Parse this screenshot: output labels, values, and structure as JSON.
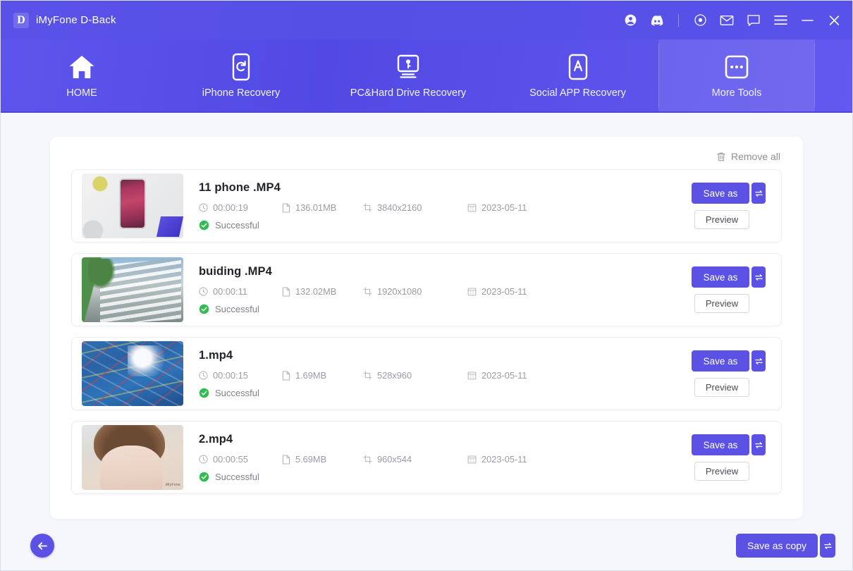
{
  "window": {
    "brand_logo": "D",
    "title": "iMyFone D-Back",
    "titlebar_icons": [
      {
        "name": "account-icon",
        "label": "Account"
      },
      {
        "name": "discord-icon",
        "label": "Discord"
      },
      {
        "name": "record-icon",
        "label": "Record"
      },
      {
        "name": "mail-icon",
        "label": "Mail"
      },
      {
        "name": "feedback-icon",
        "label": "Feedback"
      },
      {
        "name": "menu-icon",
        "label": "Menu"
      }
    ],
    "minimize_label": "Minimize",
    "close_label": "Close"
  },
  "nav": {
    "items": [
      {
        "label": "HOME",
        "icon": "home-icon",
        "active": false
      },
      {
        "label": "iPhone Recovery",
        "icon": "phone-refresh-icon",
        "active": false
      },
      {
        "label": "PC&Hard Drive Recovery",
        "icon": "monitor-key-icon",
        "active": false
      },
      {
        "label": "Social APP Recovery",
        "icon": "app-store-icon",
        "active": false
      },
      {
        "label": "More Tools",
        "icon": "more-dots-icon",
        "active": true
      }
    ]
  },
  "panel": {
    "remove_all_label": "Remove all"
  },
  "files": [
    {
      "name": "11 phone .MP4",
      "duration": "00:00:19",
      "size": "136.01MB",
      "resolution": "3840x2160",
      "date": "2023-05-11",
      "status": "Successful",
      "save_label": "Save as",
      "preview_label": "Preview",
      "thumb_class": "th1",
      "watermark": ""
    },
    {
      "name": "buiding .MP4",
      "duration": "00:00:11",
      "size": "132.02MB",
      "resolution": "1920x1080",
      "date": "2023-05-11",
      "status": "Successful",
      "save_label": "Save as",
      "preview_label": "Preview",
      "thumb_class": "th2",
      "watermark": ""
    },
    {
      "name": "1.mp4",
      "duration": "00:00:15",
      "size": "1.69MB",
      "resolution": "528x960",
      "date": "2023-05-11",
      "status": "Successful",
      "save_label": "Save as",
      "preview_label": "Preview",
      "thumb_class": "th3",
      "watermark": ""
    },
    {
      "name": "2.mp4",
      "duration": "00:00:55",
      "size": "5.69MB",
      "resolution": "960x544",
      "date": "2023-05-11",
      "status": "Successful",
      "save_label": "Save as",
      "preview_label": "Preview",
      "thumb_class": "th4",
      "watermark": "iMyFone"
    }
  ],
  "footer": {
    "back_label": "Back",
    "save_as_copy_label": "Save as copy"
  },
  "colors": {
    "accent": "#5b51e5",
    "header_gradient_start": "#5d55ec",
    "header_gradient_end": "#6358ef",
    "page_background": "#f6f7fd",
    "status_success": "#2ebd4e",
    "meta_text": "#9a9ca5"
  }
}
